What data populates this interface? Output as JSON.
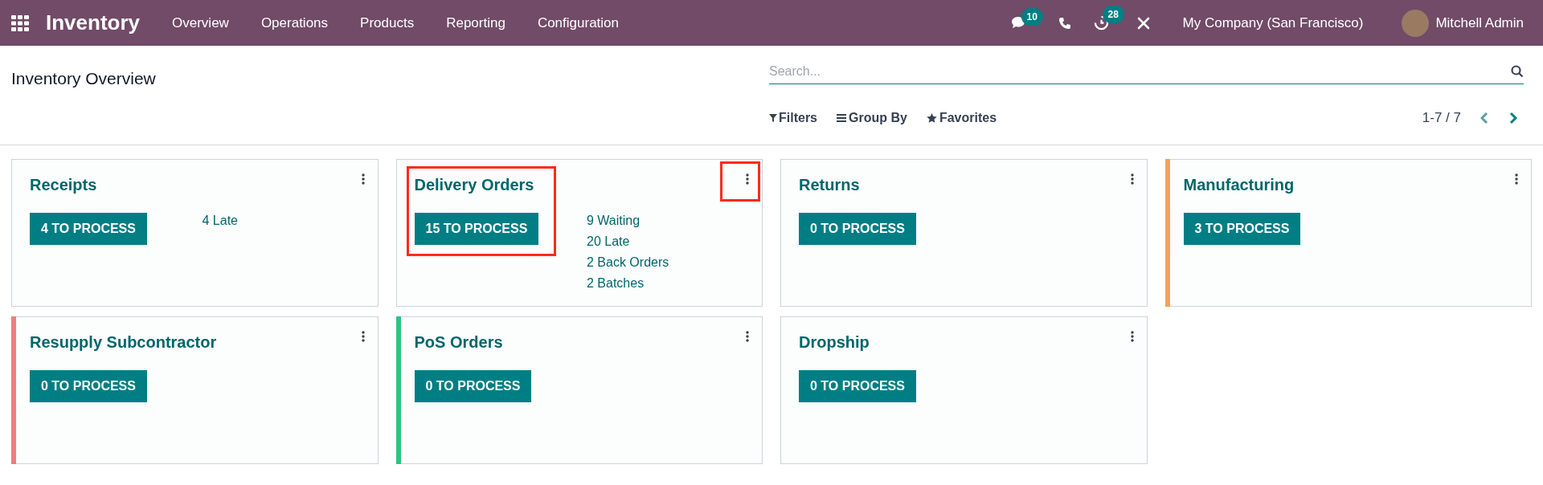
{
  "navbar": {
    "app_name": "Inventory",
    "menu": [
      "Overview",
      "Operations",
      "Products",
      "Reporting",
      "Configuration"
    ],
    "messages_count": "10",
    "activities_count": "28",
    "company": "My Company (San Francisco)",
    "user": "Mitchell Admin"
  },
  "control_panel": {
    "title": "Inventory Overview",
    "search": {
      "placeholder": "Search..."
    },
    "filters": [
      "Filters",
      "Group By",
      "Favorites"
    ],
    "pager": "1-7 / 7"
  },
  "cards": [
    {
      "title": "Receipts",
      "button": "4 TO PROCESS",
      "stats": [
        "4 Late"
      ],
      "annotated": false
    },
    {
      "title": "Delivery Orders",
      "button": "15 TO PROCESS",
      "stats": [
        "9 Waiting",
        "20 Late",
        "2 Back Orders",
        "2 Batches"
      ],
      "annotated": true
    },
    {
      "title": "Returns",
      "button": "0 TO PROCESS",
      "annotated": false
    },
    {
      "title": "Manufacturing",
      "button": "3 TO PROCESS",
      "color": "#f0a35e",
      "annotated": false
    },
    {
      "title": "Resupply Subcontractor",
      "button": "0 TO PROCESS",
      "color": "#e88080",
      "annotated": false
    },
    {
      "title": "PoS Orders",
      "button": "0 TO PROCESS",
      "color": "#30c381",
      "annotated": false
    },
    {
      "title": "Dropship",
      "button": "0 TO PROCESS",
      "annotated": false
    }
  ]
}
